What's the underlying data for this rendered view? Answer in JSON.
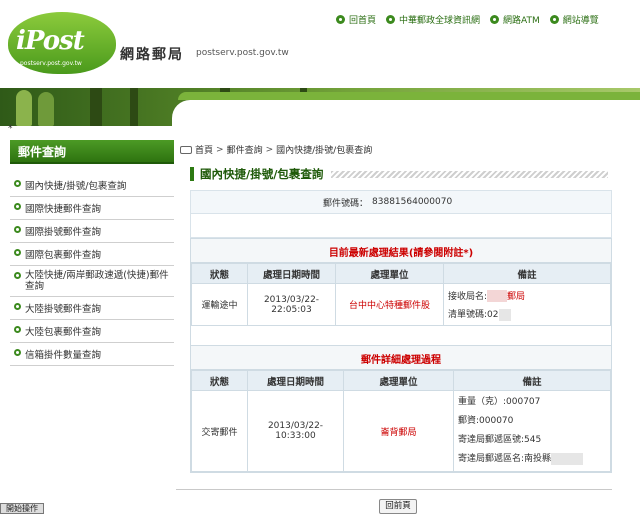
{
  "header": {
    "logo_text": "iPost",
    "logo_url": "postserv.post.gov.tw",
    "site_name": "網路郵局",
    "site_domain": "postserv.post.gov.tw",
    "nav": [
      {
        "label": "回首頁"
      },
      {
        "label": "中華郵政全球資訊網"
      },
      {
        "label": "網路ATM"
      },
      {
        "label": "網站導覽"
      }
    ]
  },
  "asterisk": "*",
  "sidebar": {
    "title": "郵件查詢",
    "items": [
      {
        "label": "國內快捷/掛號/包裹查詢"
      },
      {
        "label": "國際快捷郵件查詢"
      },
      {
        "label": "國際掛號郵件查詢"
      },
      {
        "label": "國際包裹郵件查詢"
      },
      {
        "label": "大陸快捷/兩岸郵政速遞(快捷)郵件查詢"
      },
      {
        "label": "大陸掛號郵件查詢"
      },
      {
        "label": "大陸包裹郵件查詢"
      },
      {
        "label": "信箱掛件數量查詢"
      }
    ]
  },
  "breadcrumb": {
    "home": "首頁",
    "sep": ">",
    "level1": "郵件查詢",
    "level2": "國內快捷/掛號/包裹查詢"
  },
  "page_title": "國內快捷/掛號/包裹查詢",
  "mail_number": {
    "label": "郵件號碼：",
    "value": "83881564000070"
  },
  "latest": {
    "title": "目前最新處理結果",
    "note": "(請參閱附註*)",
    "headers": [
      "狀態",
      "處理日期時間",
      "處理單位",
      "備註"
    ],
    "row": {
      "status": "運輸途中",
      "datetime": "2013/03/22-22:05:03",
      "unit": "台中中心特種郵件股",
      "remark1_prefix": "接收局名:",
      "remark1_suffix": "郵局",
      "remark2_prefix": "清單號碼:02"
    }
  },
  "detail": {
    "title": "郵件詳細處理過程",
    "headers": [
      "狀態",
      "處理日期時間",
      "處理單位",
      "備註"
    ],
    "row": {
      "status": "交寄郵件",
      "datetime": "2013/03/22-10:33:00",
      "unit": "崙背郵局",
      "remarks": [
        "重量（克）:000707",
        "郵資:000070",
        "寄達局郵遞區號:545",
        "寄達局郵遞區名:南投縣"
      ]
    }
  },
  "back_button": "回前頁",
  "taskbar_start": "開始操作",
  "colors": {
    "brand_green": "#2d7a12",
    "accent_red": "#cc0000",
    "table_header_bg": "#e6eef4"
  }
}
